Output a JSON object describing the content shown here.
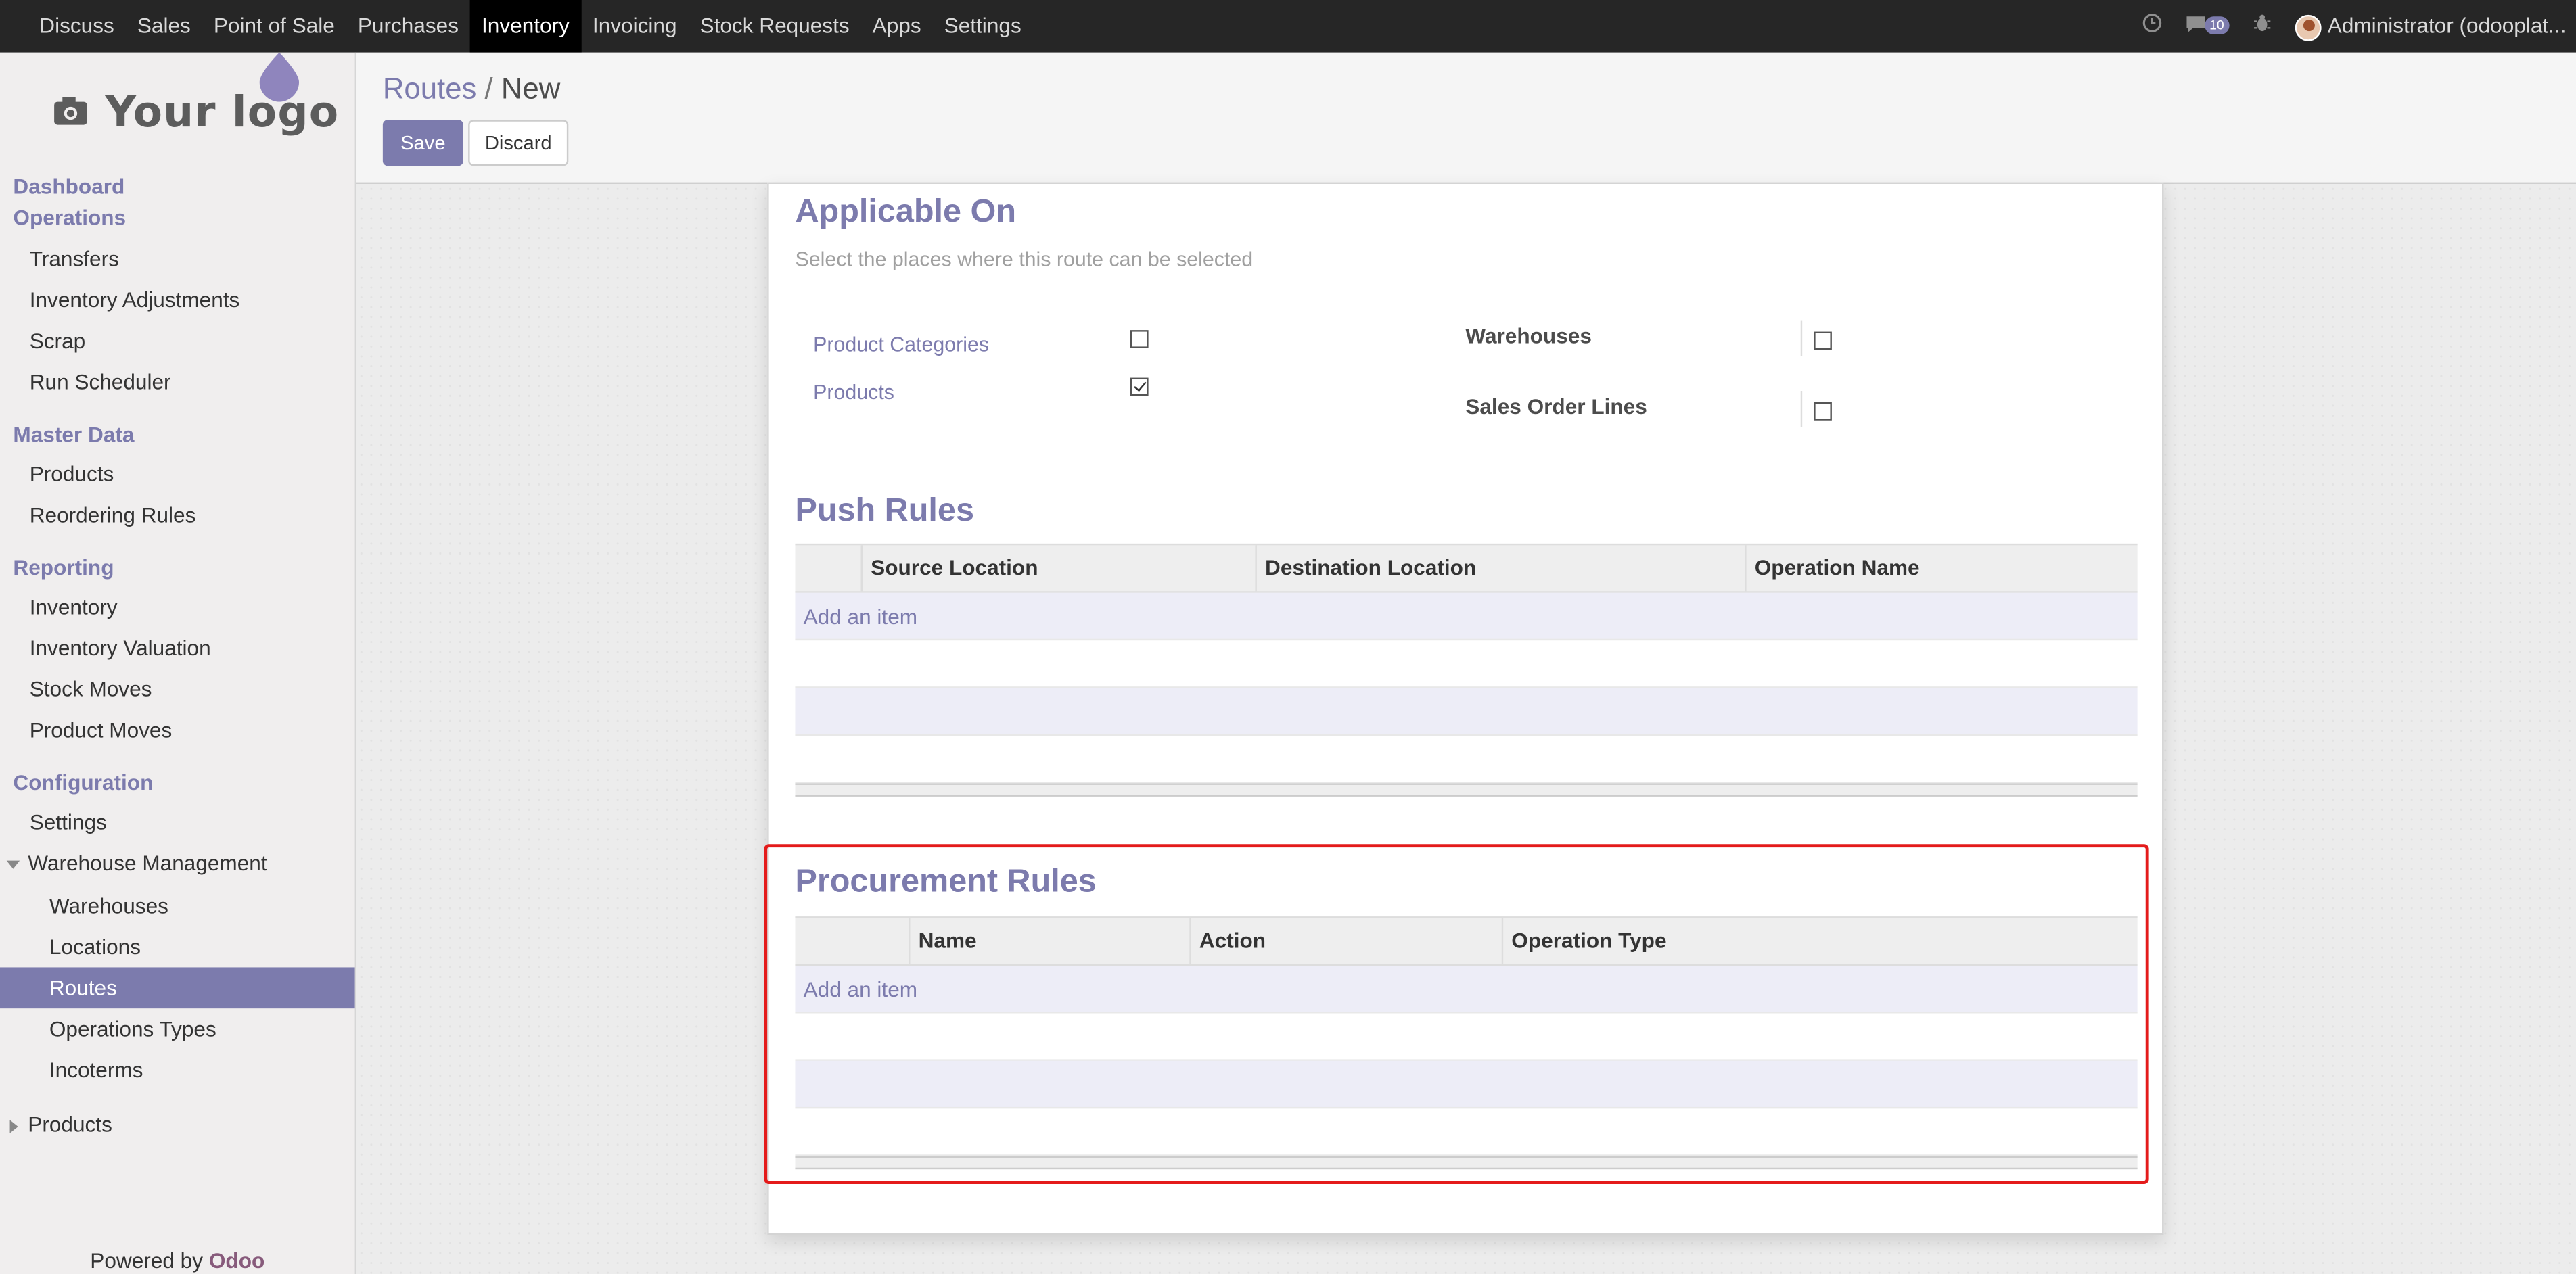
{
  "navbar": {
    "apps": [
      "Discuss",
      "Sales",
      "Point of Sale",
      "Purchases",
      "Inventory",
      "Invoicing",
      "Stock Requests",
      "Apps",
      "Settings"
    ],
    "active_app": "Inventory",
    "message_count": "10",
    "user": "Administrator (odooplat..."
  },
  "logo": {
    "text": "Your logo"
  },
  "sidebar": {
    "sections": {
      "dashboard": "Dashboard",
      "operations": "Operations",
      "master_data": "Master Data",
      "reporting": "Reporting",
      "configuration": "Configuration"
    },
    "operations_items": [
      "Transfers",
      "Inventory Adjustments",
      "Scrap",
      "Run Scheduler"
    ],
    "master_items": [
      "Products",
      "Reordering Rules"
    ],
    "reporting_items": [
      "Inventory",
      "Inventory Valuation",
      "Stock Moves",
      "Product Moves"
    ],
    "config_settings": "Settings",
    "warehouse_management": "Warehouse Management",
    "warehouse_items": [
      "Warehouses",
      "Locations",
      "Routes",
      "Operations Types",
      "Incoterms"
    ],
    "active_item": "Routes",
    "products_group": "Products",
    "powered_prefix": "Powered by",
    "powered_brand": "Odoo"
  },
  "control_panel": {
    "breadcrumb_parent": "Routes",
    "breadcrumb_sep": "/",
    "breadcrumb_current": "New",
    "save_label": "Save",
    "discard_label": "Discard"
  },
  "form": {
    "applicable_on": {
      "title": "Applicable On",
      "hint": "Select the places where this route can be selected",
      "product_categories": {
        "label": "Product Categories",
        "checked": false
      },
      "products": {
        "label": "Products",
        "checked": true
      },
      "warehouses": {
        "label": "Warehouses",
        "checked": false
      },
      "sales_order_lines": {
        "label": "Sales Order Lines",
        "checked": false
      }
    },
    "push_rules": {
      "title": "Push Rules",
      "columns": [
        "Source Location",
        "Destination Location",
        "Operation Name"
      ],
      "add_item": "Add an item"
    },
    "procurement_rules": {
      "title": "Procurement Rules",
      "columns": [
        "Name",
        "Action",
        "Operation Type"
      ],
      "add_item": "Add an item"
    }
  },
  "colors": {
    "accent": "#7c7bad",
    "navbar": "#262626",
    "highlight": "#e41b1b"
  }
}
